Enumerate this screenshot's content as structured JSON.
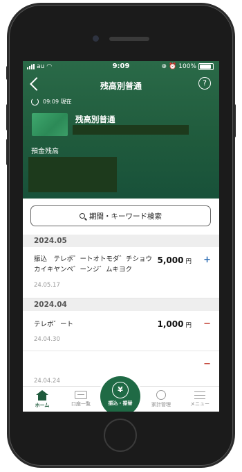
{
  "status_bar": {
    "carrier": "au",
    "time": "9:09",
    "battery": "100%"
  },
  "nav": {
    "title": "残高別普通",
    "help": "?"
  },
  "updated": {
    "text": "09:09 現在"
  },
  "account": {
    "name": "残高別普通",
    "deposit_label": "預金残高"
  },
  "search": {
    "label": "期間・キーワード検索"
  },
  "sections": [
    {
      "month": "2024.05",
      "transactions": [
        {
          "description": "振込　テレボ゛ートオトモダ゛チショウカイキヤンペ゛ーンジ゛ムキヨク",
          "date": "24.05.17",
          "amount": "5,000",
          "currency": "円",
          "sign": "+"
        }
      ]
    },
    {
      "month": "2024.04",
      "transactions": [
        {
          "description": "テレボ゛ート",
          "date": "24.04.30",
          "amount": "1,000",
          "currency": "円",
          "sign": "−"
        },
        {
          "description": "",
          "date": "24.04.24",
          "amount": "",
          "currency": "",
          "sign": "−"
        }
      ]
    }
  ],
  "tabbar": {
    "home": "ホーム",
    "accounts": "口座一覧",
    "transfer": "振込・振替",
    "household": "家計管理",
    "menu": "メニュー"
  },
  "colors": {
    "brand_green": "#1f5a3c",
    "plus": "#2f6fb5",
    "minus": "#c0392b"
  }
}
